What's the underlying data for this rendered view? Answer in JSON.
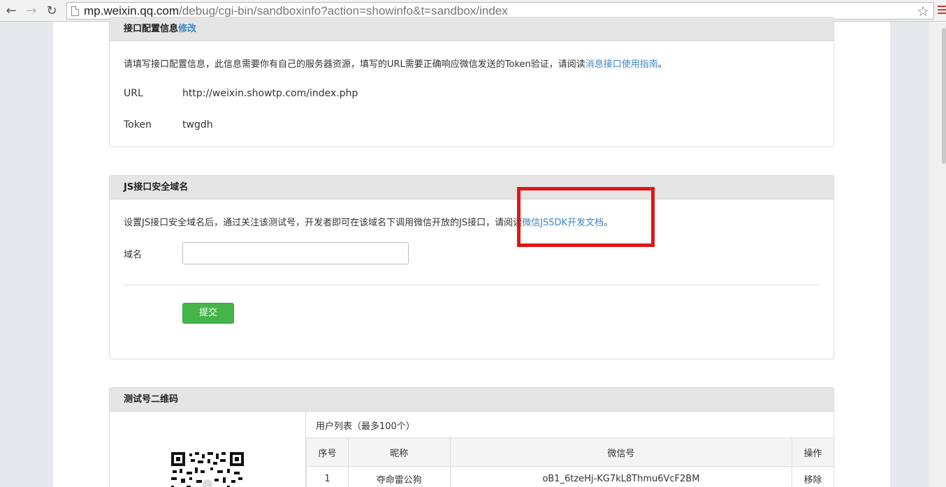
{
  "browser": {
    "url_host": "mp.weixin.qq.com",
    "url_path": "/debug/cgi-bin/sandboxinfo?action=showinfo&t=sandbox/index"
  },
  "interface_config": {
    "title": "接口配置信息",
    "edit_link": "修改",
    "description": "请填写接口配置信息，此信息需要你有自己的服务器资源，填写的URL需要正确响应微信发送的Token验证，请阅读",
    "guide_link": "消息接口使用指南",
    "description_end": "。",
    "url_label": "URL",
    "url_value": "http://weixin.showtp.com/index.php",
    "token_label": "Token",
    "token_value": "twgdh"
  },
  "js_domain": {
    "title": "JS接口安全域名",
    "description": "设置JS接口安全域名后，通过关注该测试号，开发者即可在该域名下调用微信开放的JS接口，请阅读",
    "doc_link": "微信JSSDK开发文档",
    "description_end": "。",
    "domain_label": "域名",
    "domain_value": "",
    "submit_label": "提交"
  },
  "qr_section": {
    "title": "测试号二维码",
    "user_list_title": "用户列表（最多100个）",
    "columns": [
      "序号",
      "昵称",
      "微信号",
      "操作"
    ],
    "rows": [
      {
        "index": "1",
        "nickname": "夺命雷公狗",
        "wechat_id": "oB1_6tzeHj-KG7kL8Thmu6VcF2BM",
        "action": "移除"
      }
    ]
  },
  "colors": {
    "link": "#3c85c2",
    "submit": "#44b549",
    "annotation": "#e11616"
  }
}
